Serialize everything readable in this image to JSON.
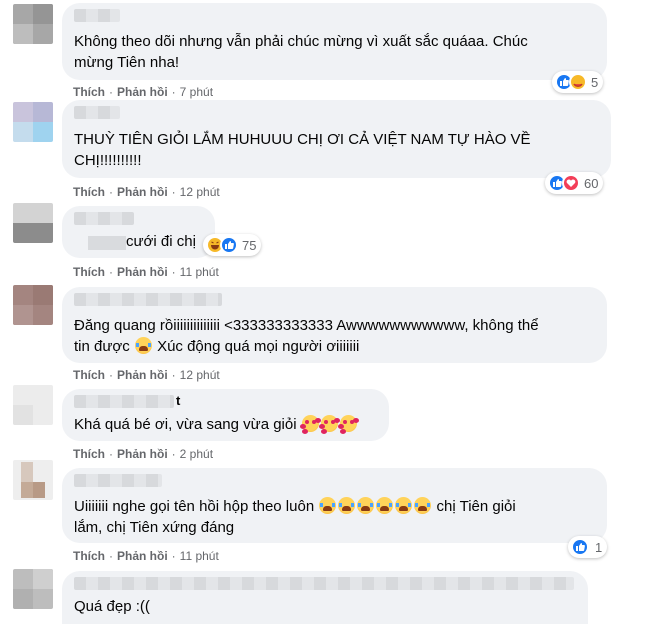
{
  "colors": {
    "bubble": "#f0f2f5",
    "meta_text": "#65676b",
    "like_blue": "#1877f2",
    "heart_red": "#f33e58",
    "haha_yellow": "#f7b928"
  },
  "comments": [
    {
      "lines": [
        "Không theo dõi nhưng vẫn phải chúc mừng vì xuất sắc quáaa. Chúc",
        "mừng Tiên nha!"
      ],
      "like_label": "Thích",
      "reply_label": "Phản hồi",
      "time": "7 phút",
      "reactions": [
        "like-icon",
        "care-icon"
      ],
      "reaction_count": "5"
    },
    {
      "lines": [
        "THUỲ TIÊN GIỎI LẮM HUHUUU CHỊ ƠI CẢ VIỆT NAM TỰ HÀO VỀ",
        "CHỊ!!!!!!!!!!"
      ],
      "like_label": "Thích",
      "reply_label": "Phản hồi",
      "time": "12 phút",
      "reactions": [
        "like-icon",
        "heart-icon"
      ],
      "reaction_count": "60"
    },
    {
      "lines": [
        "cưới đi chị"
      ],
      "like_label": "Thích",
      "reply_label": "Phản hồi",
      "time": "11 phút",
      "reactions": [
        "haha-icon",
        "like-icon"
      ],
      "reaction_count": "75"
    },
    {
      "lines": [
        "Đăng quang rồiiiiiiiiiiiiii <333333333333 Awwwwwwwwwww, không thể",
        "tin được",
        "Xúc động quá mọi người ơiiiiiii"
      ],
      "like_label": "Thích",
      "reply_label": "Phản hồi",
      "time": "12 phút"
    },
    {
      "name_suffix": "t",
      "lines": [
        "Khá quá bé ơi, vừa sang vừa giỏi"
      ],
      "like_label": "Thích",
      "reply_label": "Phản hồi",
      "time": "2 phút"
    },
    {
      "lines": [
        "Uiiiiiii nghe gọi tên hồi hộp theo luôn",
        "chị Tiên giỏi",
        "lắm, chị Tiên xứng đáng"
      ],
      "like_label": "Thích",
      "reply_label": "Phản hồi",
      "time": "11 phút",
      "reactions": [
        "like-icon"
      ],
      "reaction_count": "1"
    },
    {
      "lines": [
        "Quá đẹp :(("
      ]
    }
  ]
}
